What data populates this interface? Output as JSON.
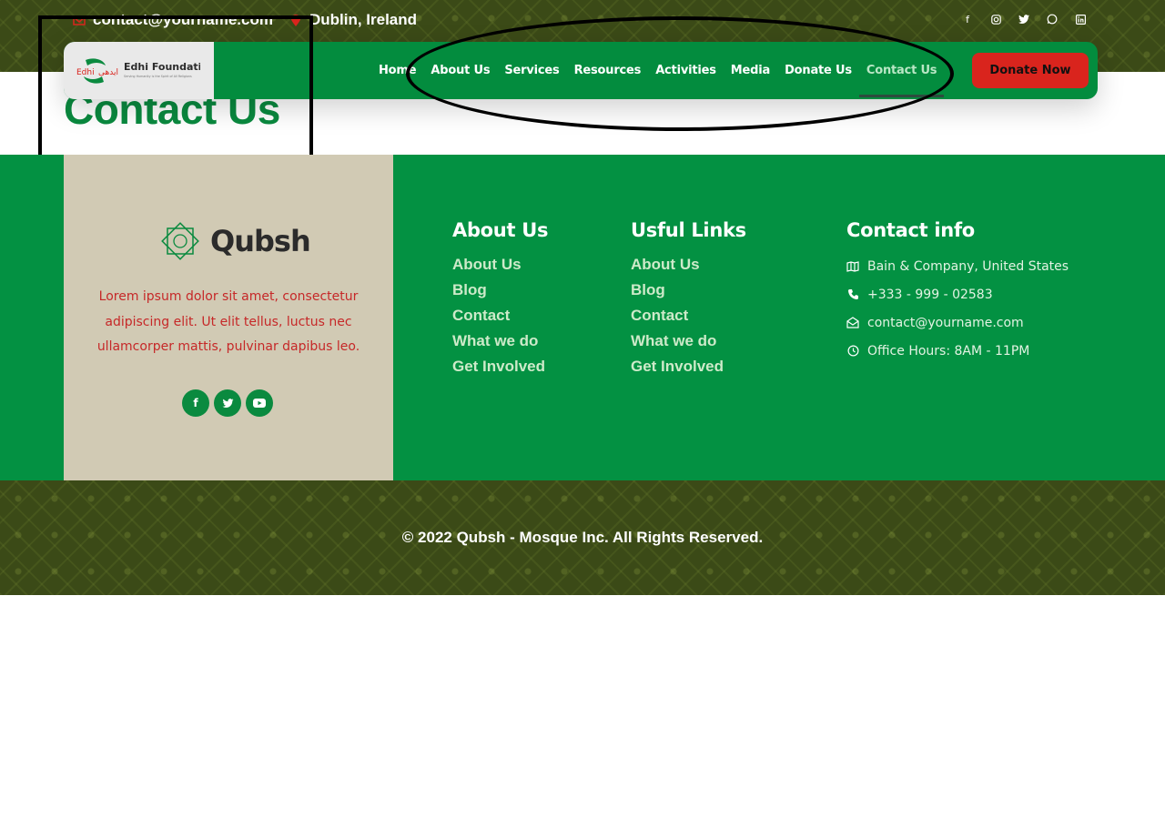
{
  "topbar": {
    "email": "contact@yourname.com",
    "location": "Dublin, Ireland",
    "social_icons": [
      "facebook-icon",
      "instagram-icon",
      "twitter-icon",
      "whatsapp-icon",
      "linkedin-icon"
    ]
  },
  "nav": {
    "logo_text": "Edhi Foundation",
    "logo_tagline": "Serving Humanity is the Spirit of All Religions",
    "logo_mark_text": "Edhi",
    "items": [
      {
        "label": "Home"
      },
      {
        "label": "About Us"
      },
      {
        "label": "Services"
      },
      {
        "label": "Resources"
      },
      {
        "label": "Activities"
      },
      {
        "label": "Media"
      },
      {
        "label": "Donate Us"
      },
      {
        "label": "Contact Us"
      }
    ],
    "active_item": "Contact Us",
    "donate_label": "Donate Now"
  },
  "page": {
    "title": "Contact Us"
  },
  "footer": {
    "brand": "Qubsh",
    "about_text": "Lorem ipsum dolor sit amet, consectetur adipiscing elit. Ut elit tellus, luctus nec ullamcorper mattis, pulvinar dapibus leo.",
    "about_social": [
      "facebook-icon",
      "twitter-icon",
      "youtube-icon"
    ],
    "about_col": {
      "heading": "About Us",
      "links": [
        "About Us",
        "Blog",
        "Contact",
        "What we do",
        "Get Involved"
      ]
    },
    "useful_col": {
      "heading": "Usful Links",
      "links": [
        "About Us",
        "Blog",
        "Contact",
        "What we do",
        "Get Involved"
      ]
    },
    "contact_col": {
      "heading": "Contact info",
      "rows": [
        {
          "icon": "map-icon",
          "text": "Bain & Company, United States"
        },
        {
          "icon": "phone-icon",
          "text": "+333 - 999 - 02583"
        },
        {
          "icon": "envelope-open-icon",
          "text": "contact@yourname.com"
        },
        {
          "icon": "clock-icon",
          "text": "Office Hours: 8AM - 11PM"
        }
      ]
    },
    "copyright": "© 2022 Qubsh - Mosque Inc. All Rights Reserved."
  },
  "colors": {
    "brand_green": "#038c3e",
    "footer_green": "#039142",
    "olive": "#3b4a17",
    "sand": "#d1cab4",
    "donate_red": "#d9241d",
    "title_green": "#0a8a3f"
  }
}
